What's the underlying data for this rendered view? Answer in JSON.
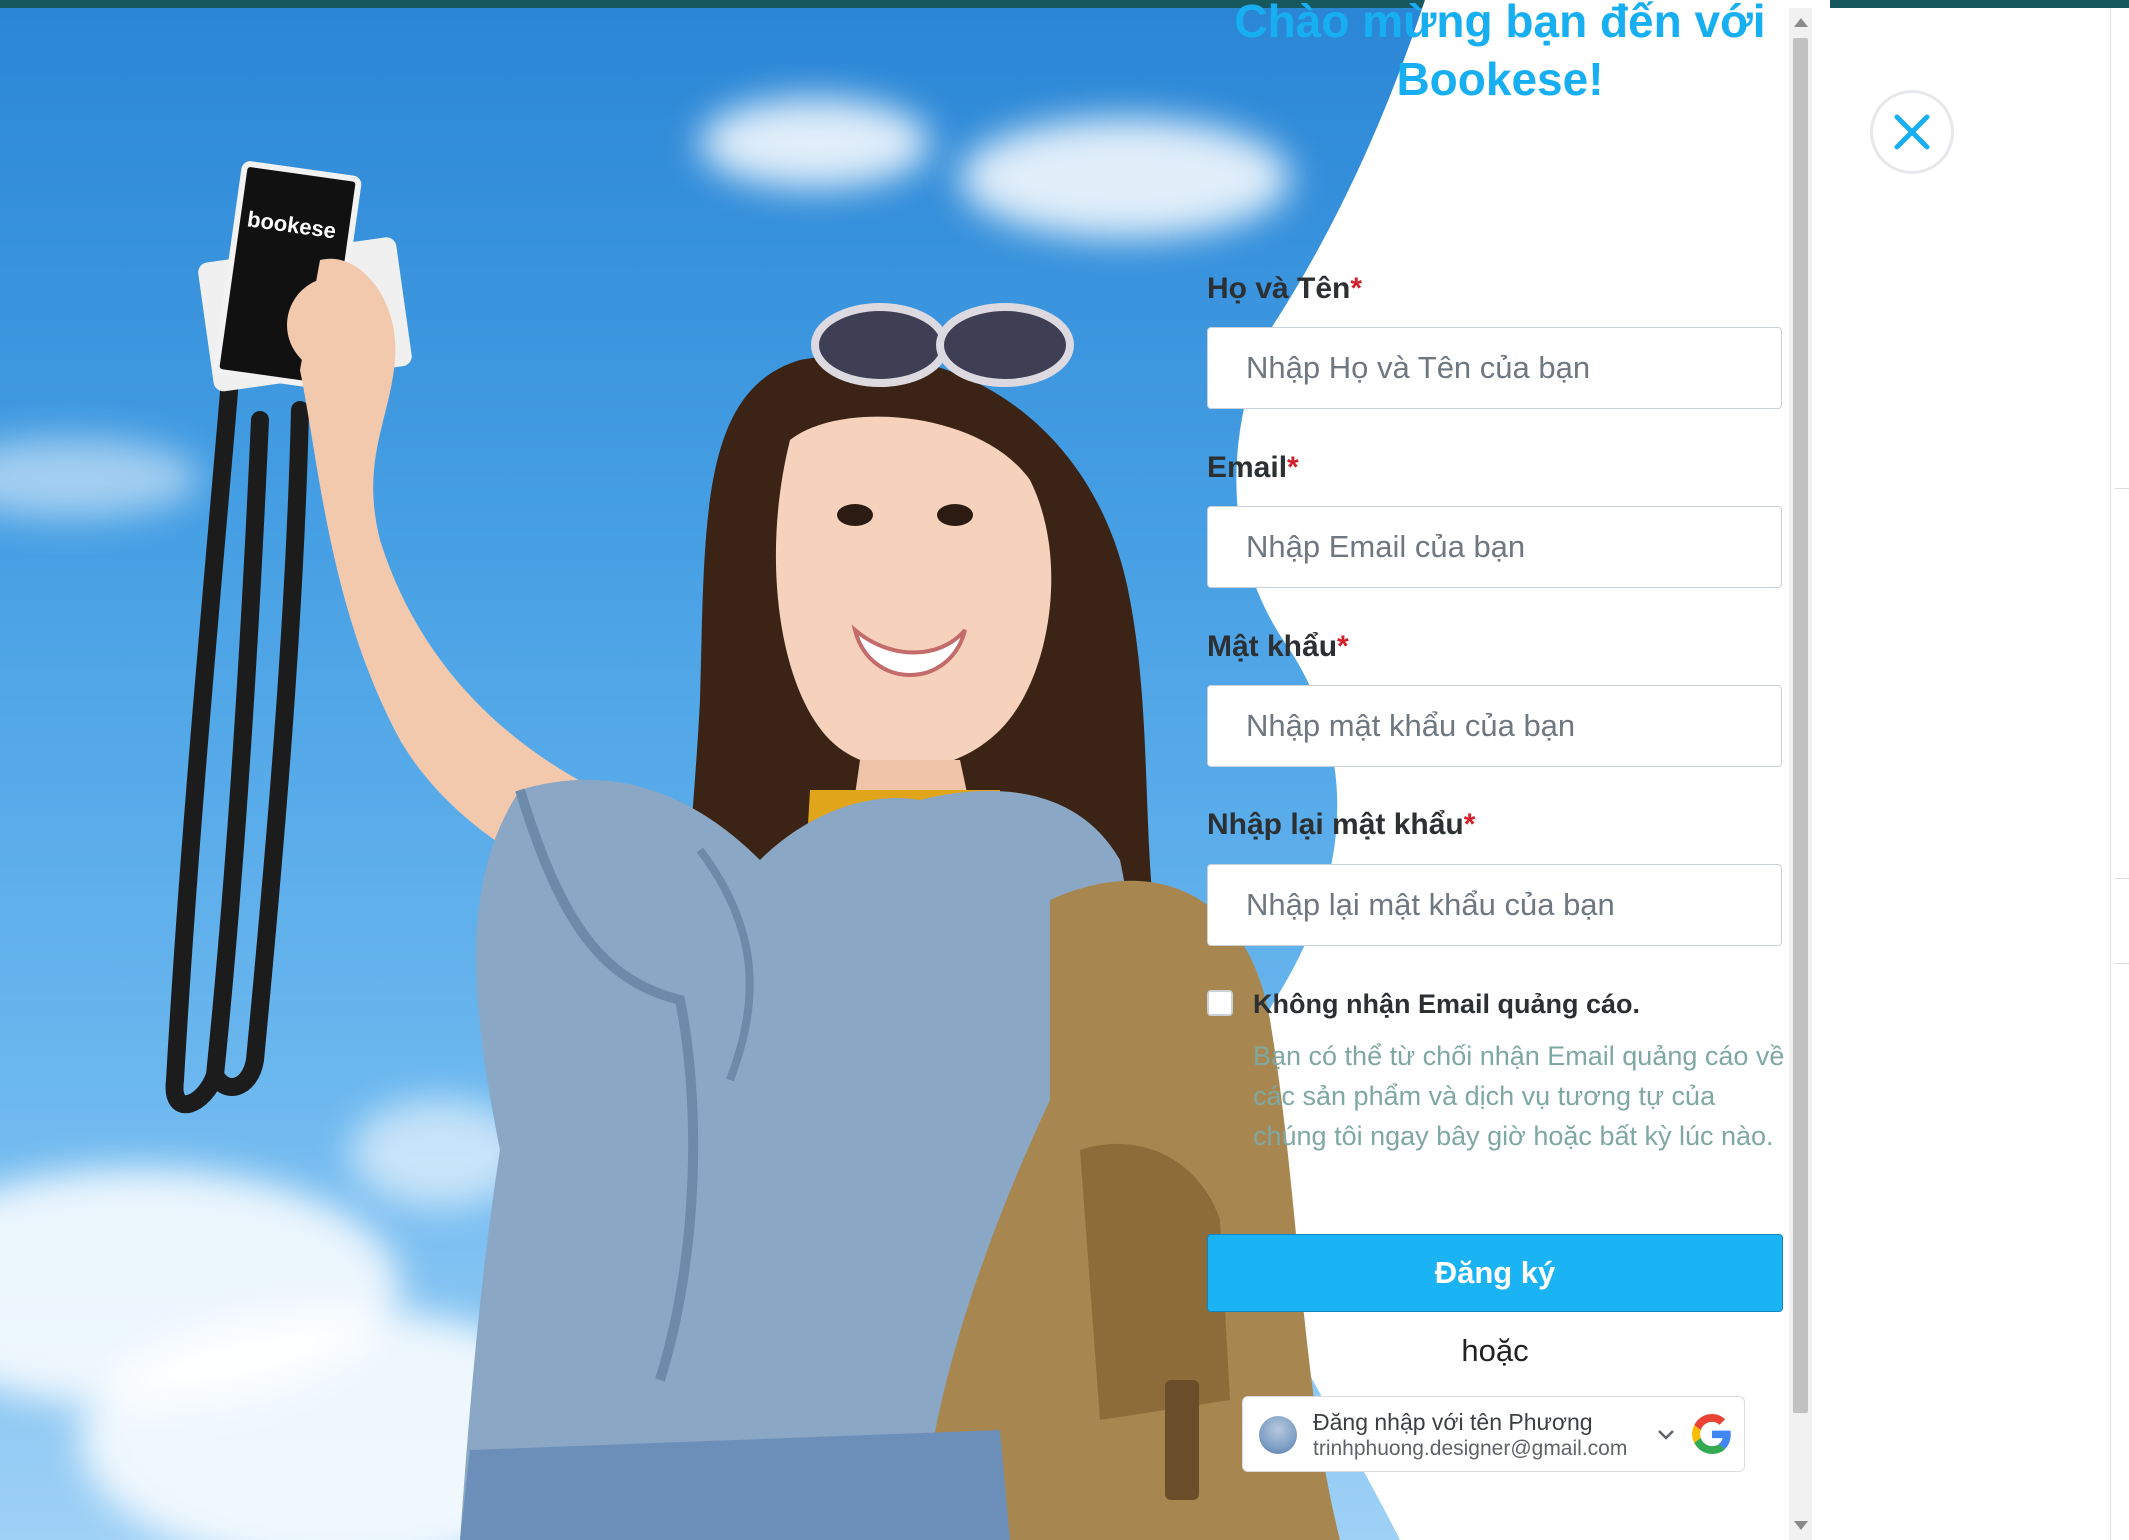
{
  "modal": {
    "welcome_line1": "Chào mừng bạn đến với",
    "welcome_line2": "Bookese!",
    "camera_brand": "bookese"
  },
  "form": {
    "fullname": {
      "label": "Họ và Tên",
      "required_mark": "*",
      "placeholder": "Nhập Họ và Tên của bạn"
    },
    "email": {
      "label": "Email",
      "required_mark": "*",
      "placeholder": "Nhập Email của bạn"
    },
    "password": {
      "label": "Mật khẩu",
      "required_mark": "*",
      "placeholder": "Nhập mật khẩu của bạn"
    },
    "confirm_password": {
      "label": "Nhập lại mật khẩu",
      "required_mark": "*",
      "placeholder": "Nhập lại mật khẩu của bạn"
    },
    "opt_out": {
      "checked": false,
      "label": "Không nhận Email quảng cáo.",
      "description": "Bạn có thể từ chối nhận Email quảng cáo về các sản phẩm và dịch vụ tương tự của chúng tôi ngay bây giờ hoặc bất kỳ lúc nào."
    },
    "submit_label": "Đăng ký",
    "or_text": "hoặc"
  },
  "google_signin": {
    "title": "Đăng nhập với tên Phương",
    "email": "trinhphuong.designer@gmail.com",
    "chevron_icon": "chevron-down-icon",
    "logo_icon": "google-logo-icon"
  },
  "close_icon": "close-icon",
  "colors": {
    "accent": "#18aff2",
    "required": "#d21f2b",
    "consent_text": "#7fa8a2",
    "top_strip": "#17585f"
  }
}
